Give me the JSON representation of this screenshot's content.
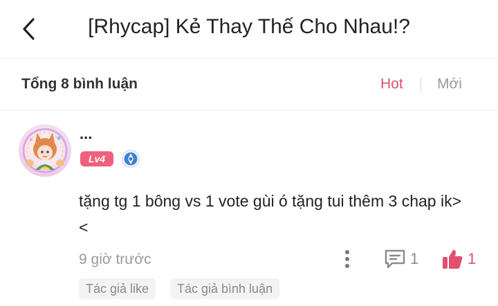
{
  "header": {
    "title": "[Rhycap] Kẻ Thay Thế Cho Nhau!?"
  },
  "sort": {
    "total": "Tổng 8 bình luận",
    "hot": "Hot",
    "new": "Mới",
    "active": "Hot"
  },
  "comment": {
    "username": "...",
    "level": "Lv4",
    "text": "tặng tg 1 bông vs 1 vote gùi ó tặng tui thêm 3 chap ik><",
    "time": "9 giờ trước",
    "reply_count": "1",
    "like_count": "1",
    "tags": [
      "Tác giả like",
      "Tác giả bình luận"
    ]
  },
  "colors": {
    "accent": "#e0506d",
    "muted": "#9a9a9a",
    "badge": "#f0607c",
    "medal": "#3f7fd6"
  },
  "icons": {
    "back": "chevron-left-icon",
    "more": "more-vertical-icon",
    "reply": "comment-icon",
    "like": "thumbs-up-icon",
    "medal": "medal-icon"
  }
}
